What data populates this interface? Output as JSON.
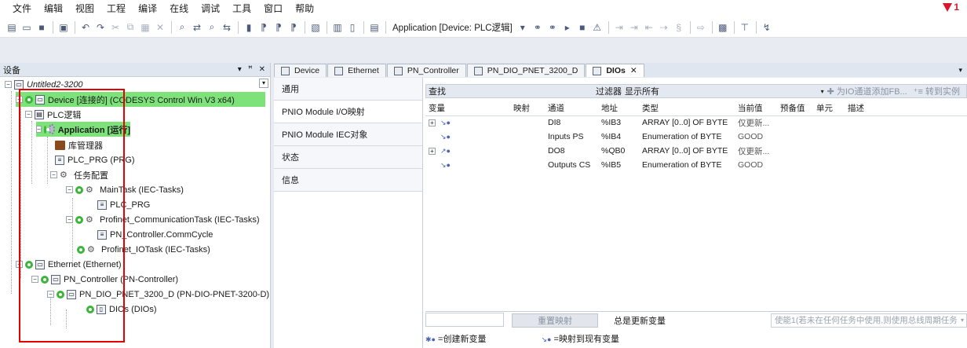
{
  "menu": [
    "文件",
    "编辑",
    "视图",
    "工程",
    "编译",
    "在线",
    "调试",
    "工具",
    "窗口",
    "帮助"
  ],
  "alarm_count": "1",
  "toolbar": {
    "application_combo": "Application [Device: PLC逻辑]"
  },
  "left_pane": {
    "title": "设备",
    "pin": "▾ ꟸ ✕",
    "tree": [
      {
        "label": "Untitled2-3200",
        "level": 0
      },
      {
        "label": "Device [连接的] (CODESYS Control Win V3 x64)",
        "level": 1
      },
      {
        "label": "PLC逻辑",
        "level": 2
      },
      {
        "label": "Application [运行]",
        "level": 3
      },
      {
        "label": "库管理器",
        "level": 4
      },
      {
        "label": "PLC_PRG (PRG)",
        "level": 4
      },
      {
        "label": "任务配置",
        "level": 4
      },
      {
        "label": "MainTask (IEC-Tasks)",
        "level": 5
      },
      {
        "label": "PLC_PRG",
        "level": 6
      },
      {
        "label": "Profinet_CommunicationTask (IEC-Tasks)",
        "level": 5
      },
      {
        "label": "PN_Controller.CommCycle",
        "level": 6
      },
      {
        "label": "Profinet_IOTask (IEC-Tasks)",
        "level": 5
      },
      {
        "label": "Ethernet (Ethernet)",
        "level": 1
      },
      {
        "label": "PN_Controller (PN-Controller)",
        "level": 2
      },
      {
        "label": "PN_DIO_PNET_3200_D (PN-DIO-PNET-3200-D)",
        "level": 3
      },
      {
        "label": "DIOs (DIOs)",
        "level": 4
      }
    ]
  },
  "tabs": [
    {
      "label": "Device"
    },
    {
      "label": "Ethernet"
    },
    {
      "label": "PN_Controller"
    },
    {
      "label": "PN_DIO_PNET_3200_D"
    },
    {
      "label": "DIOs",
      "close": "✕"
    }
  ],
  "vtabs": [
    "通用",
    "PNIO Module I/O映射",
    "PNIO Module IEC对象",
    "状态",
    "信息"
  ],
  "filter": {
    "find_label": "查找",
    "filter_label": "过滤器",
    "filter_value": "显示所有",
    "add_fb": "为IO通道添加FB...",
    "goto_instance": "转到实例"
  },
  "table": {
    "headers": [
      "变量",
      "映射",
      "通道",
      "地址",
      "类型",
      "当前值",
      "预备值",
      "单元",
      "描述"
    ],
    "rows": [
      {
        "channel": "DI8",
        "address": "%IB3",
        "type": "ARRAY [0..0] OF BYTE",
        "current": "仅更新..."
      },
      {
        "channel": "Inputs PS",
        "address": "%IB4",
        "type": "Enumeration of BYTE",
        "current": "GOOD"
      },
      {
        "channel": "DO8",
        "address": "%QB0",
        "type": "ARRAY [0..0] OF BYTE",
        "current": "仅更新..."
      },
      {
        "channel": "Outputs CS",
        "address": "%IB5",
        "type": "Enumeration of BYTE",
        "current": "GOOD"
      }
    ]
  },
  "bottom": {
    "reset_mapping": "重置映射",
    "always_update": "总是更新变量",
    "enable_text": "使能1(若未在任何任务中使用,则使用总线周期任务"
  },
  "legend": {
    "create_new": "=创建新变量",
    "map_existing": "=映射到现有变量"
  },
  "colors": {
    "highlight_green": "#7de27a",
    "annotation_red": "#e60000",
    "alarm_red": "#d9162b"
  }
}
